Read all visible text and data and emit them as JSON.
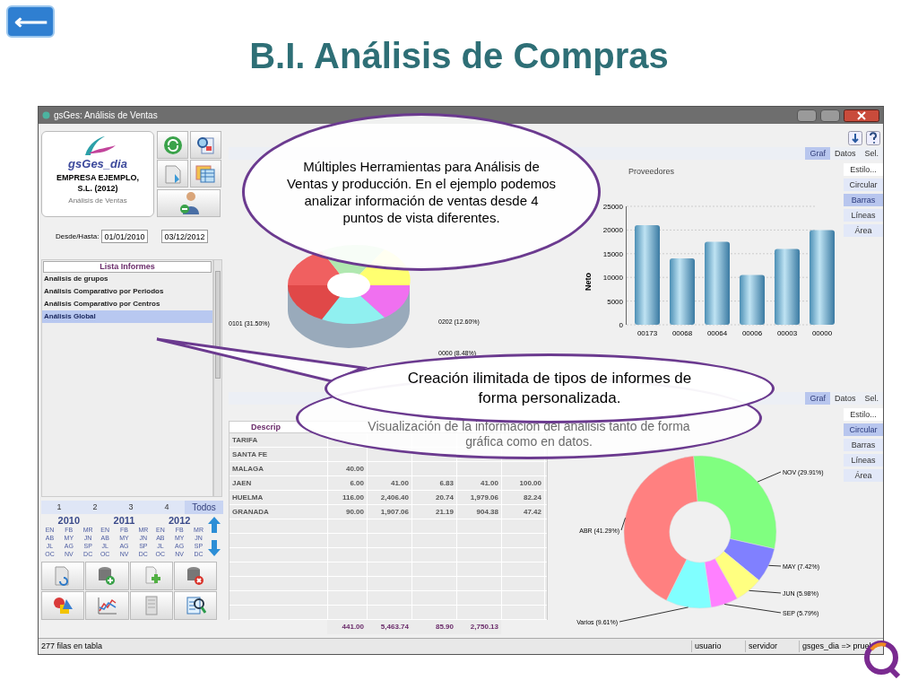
{
  "slide": {
    "back_button": "⟵",
    "title": "B.I. Análisis de Compras"
  },
  "window": {
    "title": "gsGes: Análisis de Ventas"
  },
  "company_card": {
    "app_name": "gsGes_dia",
    "company": "EMPRESA EJEMPLO,",
    "company_line_2": "S.L. (2012)",
    "module": "Análisis de Ventas"
  },
  "date_range": {
    "label": "Desde/Hasta:",
    "from": "01/01/2010",
    "to": "03/12/2012"
  },
  "report_list": {
    "header": "Lista Informes",
    "items": [
      {
        "label": "Analisis de grupos",
        "selected": false
      },
      {
        "label": "Análisis Comparativo por Periodos",
        "selected": false
      },
      {
        "label": "Análisis Comparativo por Centros",
        "selected": false
      },
      {
        "label": "Análisis Global",
        "selected": true
      }
    ]
  },
  "period_tabs": [
    {
      "label": "1",
      "selected": false
    },
    {
      "label": "2",
      "selected": false
    },
    {
      "label": "3",
      "selected": false
    },
    {
      "label": "4",
      "selected": false
    },
    {
      "label": "Todos",
      "selected": true
    }
  ],
  "years": [
    {
      "year": "2010",
      "months": [
        "EN",
        "FB",
        "MR",
        "AB",
        "MY",
        "JN",
        "JL",
        "AG",
        "SP",
        "OC",
        "NV",
        "DC"
      ]
    },
    {
      "year": "2011",
      "months": [
        "EN",
        "FB",
        "MR",
        "AB",
        "MY",
        "JN",
        "JL",
        "AG",
        "SP",
        "OC",
        "NV",
        "DC"
      ]
    },
    {
      "year": "2012",
      "months": [
        "EN",
        "FB",
        "MR",
        "AB",
        "MY",
        "JN",
        "JL",
        "AG",
        "SP",
        "OC",
        "NV",
        "DC"
      ]
    }
  ],
  "top_panel": {
    "view_tabs": [
      {
        "label": "Graf",
        "selected": true
      },
      {
        "label": "Datos",
        "selected": false
      },
      {
        "label": "Sel.",
        "selected": false
      }
    ],
    "style_buttons": [
      {
        "label": "Estilo...",
        "selected": false
      },
      {
        "label": "Circular",
        "selected": false
      },
      {
        "label": "Barras",
        "selected": true
      },
      {
        "label": "Líneas",
        "selected": false
      },
      {
        "label": "Área",
        "selected": false
      }
    ],
    "donut_labels": [
      "0101 (31.50%)",
      "0202 (12.60%)",
      "0000 (8.48%)"
    ],
    "chart_data": {
      "type": "bar",
      "grid": true,
      "title": "Proveedores",
      "ylabel": "Neto",
      "categories": [
        "00173",
        "00068",
        "00064",
        "00006",
        "00003",
        "00000"
      ],
      "values": [
        21000,
        14000,
        17500,
        10500,
        16000,
        20000
      ],
      "ylim": [
        0,
        25000
      ],
      "yticks": [
        0,
        5000,
        10000,
        15000,
        20000,
        25000
      ]
    }
  },
  "bottom_panel": {
    "view_tabs": [
      {
        "label": "Graf",
        "selected": true
      },
      {
        "label": "Datos",
        "selected": false
      },
      {
        "label": "Sel.",
        "selected": false
      }
    ],
    "style_buttons": [
      {
        "label": "Estilo...",
        "selected": false
      },
      {
        "label": "Circular",
        "selected": true
      },
      {
        "label": "Barras",
        "selected": false
      },
      {
        "label": "Líneas",
        "selected": false
      },
      {
        "label": "Área",
        "selected": false
      }
    ],
    "table": {
      "columns": [
        "Descrip"
      ],
      "rows": [
        [
          "TARIFA"
        ],
        [
          "SANTA FE"
        ],
        [
          "MALAGA",
          "40.00"
        ],
        [
          "JAEN",
          "6.00",
          "41.00",
          "6.83",
          "41.00",
          "100.00"
        ],
        [
          "HUELMA",
          "116.00",
          "2,406.40",
          "20.74",
          "1,979.06",
          "82.24"
        ],
        [
          "GRANADA",
          "90.00",
          "1,907.06",
          "21.19",
          "904.38",
          "47.42"
        ]
      ],
      "totals": [
        "441.00",
        "5,463.74",
        "85.90",
        "2,750.13"
      ]
    },
    "chart_data": {
      "type": "donut",
      "categories": [
        "NOV (29.91%)",
        "MAY (7.42%)",
        "JUN (5.98%)",
        "SEP (5.79%)",
        "Varios (9.61%)",
        "ABR (41.29%)"
      ],
      "values": [
        29.91,
        7.42,
        5.98,
        5.79,
        9.61,
        41.29
      ]
    }
  },
  "status_bar": {
    "message": "277 filas en tabla",
    "user": "usuario",
    "server": "servidor",
    "connection": "gsges_dia => pruel"
  },
  "callouts": [
    {
      "text": "Múltiples Herramientas para Análisis de Ventas y producción. En el ejemplo podemos analizar información de ventas desde 4 puntos de vista diferentes."
    },
    {
      "text": "Creación ilimitada de tipos de informes de forma personalizada."
    },
    {
      "text": "Visualización de la información del análisis tanto de forma gráfica como en datos."
    }
  ]
}
